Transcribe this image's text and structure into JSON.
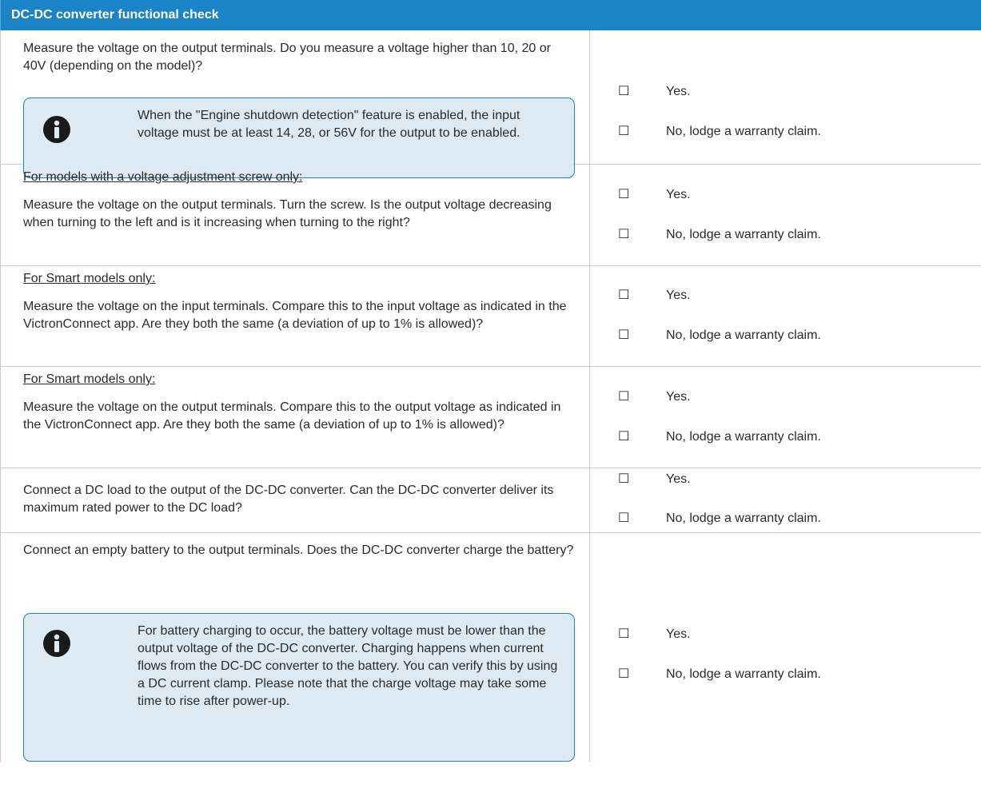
{
  "header": {
    "title": "DC-DC converter functional check"
  },
  "checkbox_glyph": "☐",
  "options": {
    "yes": "Yes.",
    "no": "No, lodge a warranty claim."
  },
  "rows": [
    {
      "question": "Measure the voltage on the output terminals. Do you measure a voltage higher than 10, 20 or 40V (depending on the model)?",
      "note": "When the \"Engine shutdown detection\" feature is enabled, the input voltage must be at least 14, 28, or 56V for the output to be enabled."
    },
    {
      "subtitle": "For models with a voltage adjustment screw only:",
      "question": "Measure the voltage on the output terminals. Turn the screw. Is the output voltage decreasing when turning to the left and is it increasing when turning to the right?"
    },
    {
      "subtitle": "For Smart models only:",
      "question": "Measure the voltage on the input terminals. Compare this to the input voltage as indicated in the VictronConnect app. Are they both the same (a deviation of up to 1% is allowed)?"
    },
    {
      "subtitle": "For Smart models only:",
      "question": "Measure the voltage on the output terminals. Compare this to the output voltage as indicated in the VictronConnect app. Are they both the same (a deviation of up to 1% is allowed)?"
    },
    {
      "question": "Connect a DC load to the output of the DC-DC converter. Can the DC-DC converter deliver its maximum rated power to the DC load?"
    },
    {
      "question": "Connect an empty battery to the output terminals. Does the DC-DC converter charge the battery?",
      "note": "For battery charging to occur, the battery voltage must be lower than the output voltage of the DC-DC converter. Charging happens when current flows from the DC-DC converter to the battery. You can verify this by using a DC current clamp. Please note that the charge voltage may take some time to rise after power-up."
    }
  ]
}
